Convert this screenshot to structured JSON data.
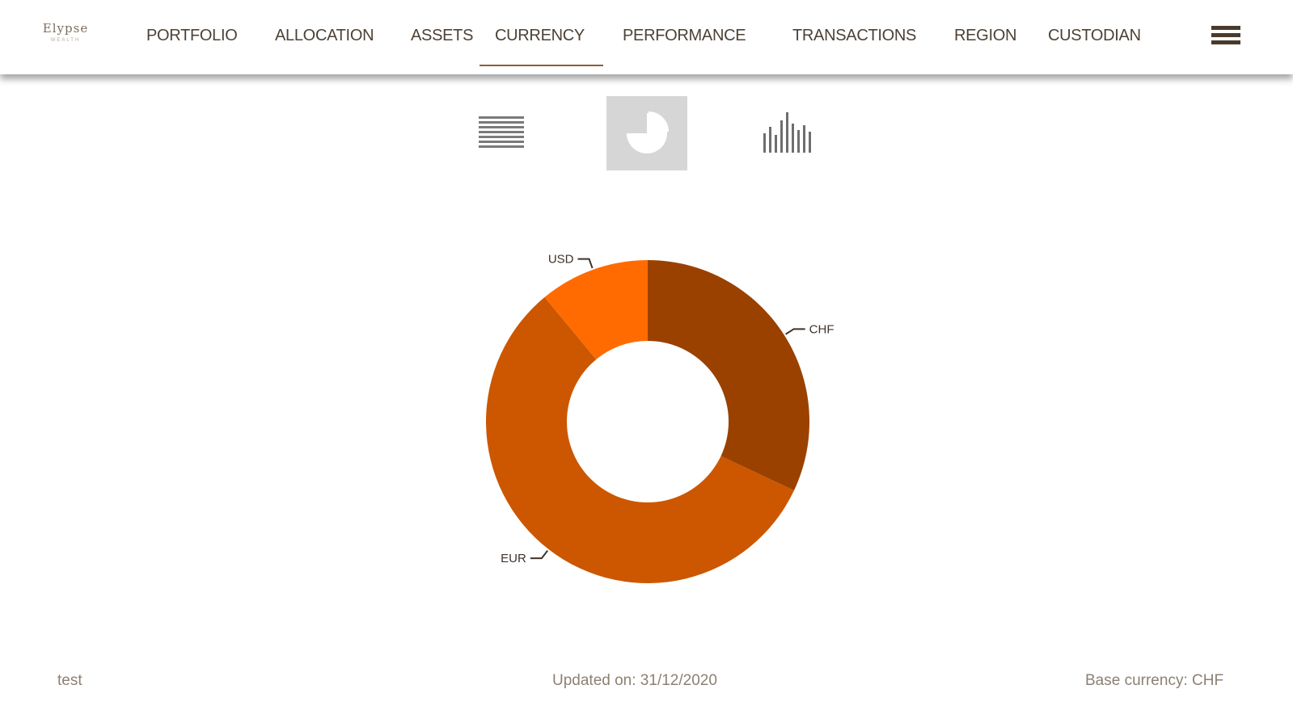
{
  "brand": {
    "name": "Elypse",
    "tagline": "Wealth"
  },
  "nav": {
    "items": [
      {
        "label": "PORTFOLIO",
        "active": false
      },
      {
        "label": "ALLOCATION",
        "active": false
      },
      {
        "label": "ASSETS",
        "active": false
      },
      {
        "label": "CURRENCY",
        "active": true
      },
      {
        "label": "PERFORMANCE",
        "active": false
      },
      {
        "label": "TRANSACTIONS",
        "active": false
      },
      {
        "label": "REGION",
        "active": false
      },
      {
        "label": "CUSTODIAN",
        "active": false
      }
    ],
    "menu_icon": "hamburger-menu-icon"
  },
  "view_switcher": {
    "options": [
      {
        "icon": "list-view-icon",
        "active": false
      },
      {
        "icon": "pie-chart-icon",
        "active": true
      },
      {
        "icon": "bar-chart-icon",
        "active": false
      }
    ]
  },
  "chart_data": {
    "type": "pie",
    "donut": true,
    "categories": [
      "CHF",
      "EUR",
      "USD"
    ],
    "values": [
      32,
      57,
      11
    ],
    "colors": [
      "#9a4100",
      "#cc5700",
      "#ff6b00"
    ],
    "title": "",
    "legend": "none"
  },
  "footer": {
    "left": "test",
    "center": "Updated on: 31/12/2020",
    "right": "Base currency: CHF"
  },
  "colors": {
    "accent": "#8b5e3c",
    "active_view_bg": "#d6d6d6",
    "footer_text": "#8c8074"
  }
}
